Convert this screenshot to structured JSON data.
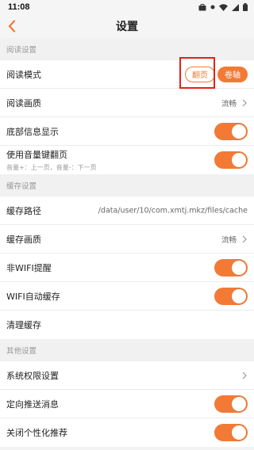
{
  "status": {
    "time": "11:08"
  },
  "header": {
    "title": "设置"
  },
  "reading": {
    "section_title": "阅读设置",
    "mode_label": "阅读模式",
    "mode_option_1": "翻页",
    "mode_option_2": "卷轴",
    "quality_label": "阅读画质",
    "quality_value": "流畅",
    "bottom_info_label": "底部信息显示",
    "bottom_info_on": true,
    "volume_label": "使用音量键翻页",
    "volume_hint": "音量+：上一页，音量-：下一页",
    "volume_on": true
  },
  "cache": {
    "section_title": "缓存设置",
    "path_label": "缓存路径",
    "path_value": "/data/user/10/com.xmtj.mkz/files/cache",
    "quality_label": "缓存画质",
    "quality_value": "流畅",
    "non_wifi_label": "非WIFI提醒",
    "non_wifi_on": true,
    "wifi_auto_label": "WIFI自动缓存",
    "wifi_auto_on": true,
    "clear_label": "清理缓存"
  },
  "other": {
    "section_title": "其他设置",
    "permissions_label": "系统权限设置",
    "push_label": "定向推送消息",
    "push_on": true,
    "personalized_label": "关闭个性化推荐",
    "personalized_on": true
  },
  "colors": {
    "accent": "#f27a35",
    "highlight": "#e5211b"
  }
}
